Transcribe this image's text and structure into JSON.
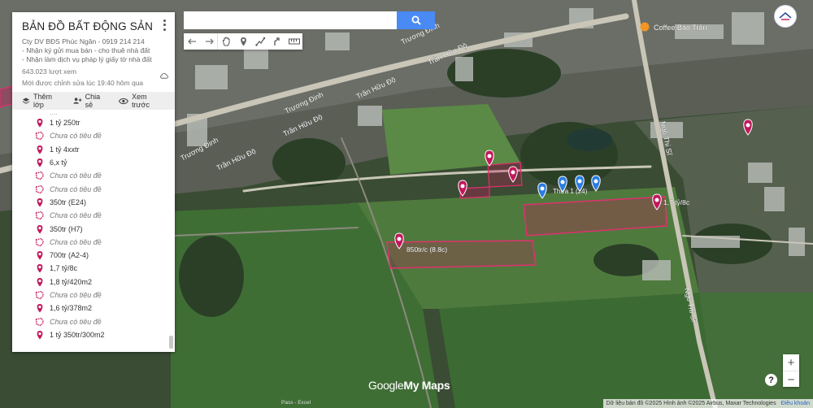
{
  "panel": {
    "title": "BẢN ĐỒ BẤT ĐỘNG SẢN",
    "description": "Cty DV BĐS Phúc Ngân - 0919 214 214\n- Nhận ký gửi mua bán - cho thuê nhà đất\n- Nhận làm dịch vụ pháp lý giấy tờ nhà đất",
    "views": "643.023 lượt xem",
    "last_edited": "Mới được chỉnh sửa lúc 19:40 hôm qua",
    "actions": {
      "add_layer": "Thêm lớp",
      "share": "Chia sẻ",
      "preview": "Xem trước"
    },
    "items": [
      {
        "label": "1 tỷ 250tr",
        "icon": "map-pin-icon",
        "untitled": false
      },
      {
        "label": "Chưa có tiêu đề",
        "icon": "polygon-icon",
        "untitled": true
      },
      {
        "label": "1 tỷ 4xxtr",
        "icon": "map-pin-icon",
        "untitled": false
      },
      {
        "label": "6,x tỷ",
        "icon": "map-pin-icon",
        "untitled": false
      },
      {
        "label": "Chưa có tiêu đề",
        "icon": "polygon-icon",
        "untitled": true
      },
      {
        "label": "Chưa có tiêu đề",
        "icon": "polygon-icon",
        "untitled": true
      },
      {
        "label": "350tr (E24)",
        "icon": "map-pin-icon",
        "untitled": false
      },
      {
        "label": "Chưa có tiêu đề",
        "icon": "polygon-icon",
        "untitled": true
      },
      {
        "label": "350tr (H7)",
        "icon": "map-pin-icon",
        "untitled": false
      },
      {
        "label": "Chưa có tiêu đề",
        "icon": "polygon-icon",
        "untitled": true
      },
      {
        "label": "700tr (A2-4)",
        "icon": "map-pin-icon",
        "untitled": false
      },
      {
        "label": "1,7 tỷ/8c",
        "icon": "map-pin-icon",
        "untitled": false
      },
      {
        "label": "1,8 tỷ/420m2",
        "icon": "map-pin-icon",
        "untitled": false
      },
      {
        "label": "Chưa có tiêu đề",
        "icon": "polygon-icon",
        "untitled": true
      },
      {
        "label": "1,6 tỷ/378m2",
        "icon": "map-pin-icon",
        "untitled": false
      },
      {
        "label": "Chưa có tiêu đề",
        "icon": "polygon-icon",
        "untitled": true
      },
      {
        "label": "1 tỷ 350tr/300m2",
        "icon": "map-pin-icon",
        "untitled": false
      }
    ]
  },
  "search": {
    "placeholder": "",
    "value": ""
  },
  "toolbar": [
    "undo-icon",
    "redo-icon",
    "hand-icon",
    "add-marker-icon",
    "draw-line-icon",
    "directions-icon",
    "measure-icon"
  ],
  "map": {
    "roads": {
      "truong_dinh_1": "Trương Định",
      "tran_huu_do_1": "Trần Hữu Độ",
      "tran_huu_do_2": "Trần Hữu Độ",
      "truong_dinh_2": "Trương Định",
      "tran_huu_do_3": "Trần Hữu Độ",
      "truong_dinh_3": "Trương Định",
      "tran_huu_do_4": "Trần Hữu Độ",
      "ngo_thi_si_1": "Ngô Thi Sĩ",
      "ngo_thi_si_2": "Ngô Thi Sĩ"
    },
    "poi_coffee": "Coffee Bảo Trân",
    "parcel_label_main": "850tr/c (8.8c)",
    "parcel_label_right": "1,7 tỷ/8c",
    "pins_label": "Thửa 1 (24)",
    "pin_color_red": "#c2185b",
    "pin_color_blue": "#2a7de1",
    "polygon_fill": "#c2185b"
  },
  "controls": {
    "zoom_in": "+",
    "zoom_out": "−",
    "help": "?"
  },
  "branding": {
    "google": "Google",
    "mymaps": "My Maps"
  },
  "attribution": {
    "text": "Dữ liệu bản đồ ©2025 Hình ảnh ©2025 Airbus, Maxar Technologies",
    "link": "Điều khoản",
    "pixel": "Pass - Excel"
  }
}
